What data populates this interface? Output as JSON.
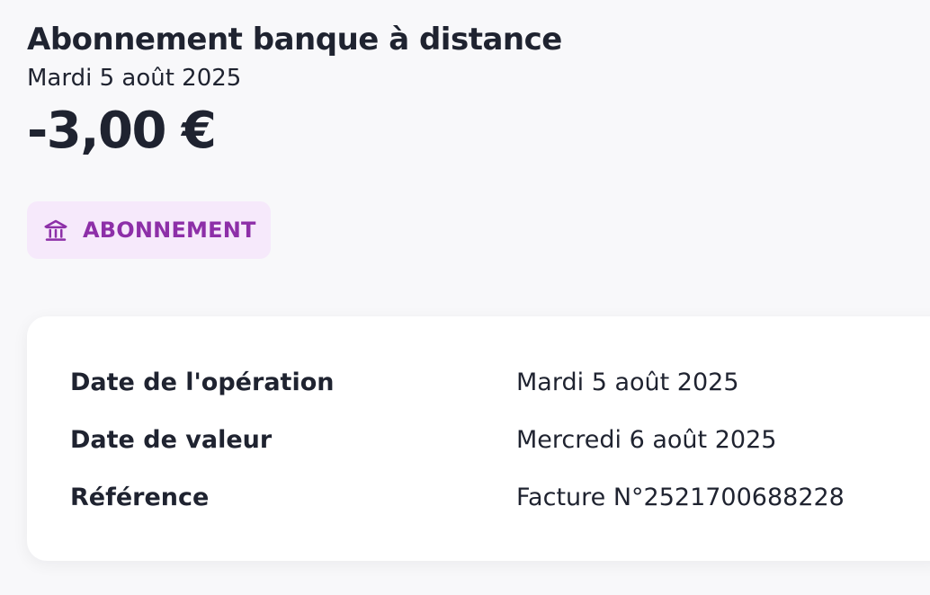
{
  "transaction": {
    "title": "Abonnement banque à distance",
    "date": "Mardi 5 août 2025",
    "amount": "-3,00 €"
  },
  "category": {
    "icon": "bank-icon",
    "label": "ABONNEMENT",
    "accent_color": "#8d2fa8",
    "background_color": "#f6e9fb"
  },
  "details": {
    "rows": [
      {
        "label": "Date de l'opération",
        "value": "Mardi 5 août 2025"
      },
      {
        "label": "Date de valeur",
        "value": "Mercredi 6 août 2025"
      },
      {
        "label": "Référence",
        "value": "Facture N°2521700688228"
      }
    ]
  }
}
